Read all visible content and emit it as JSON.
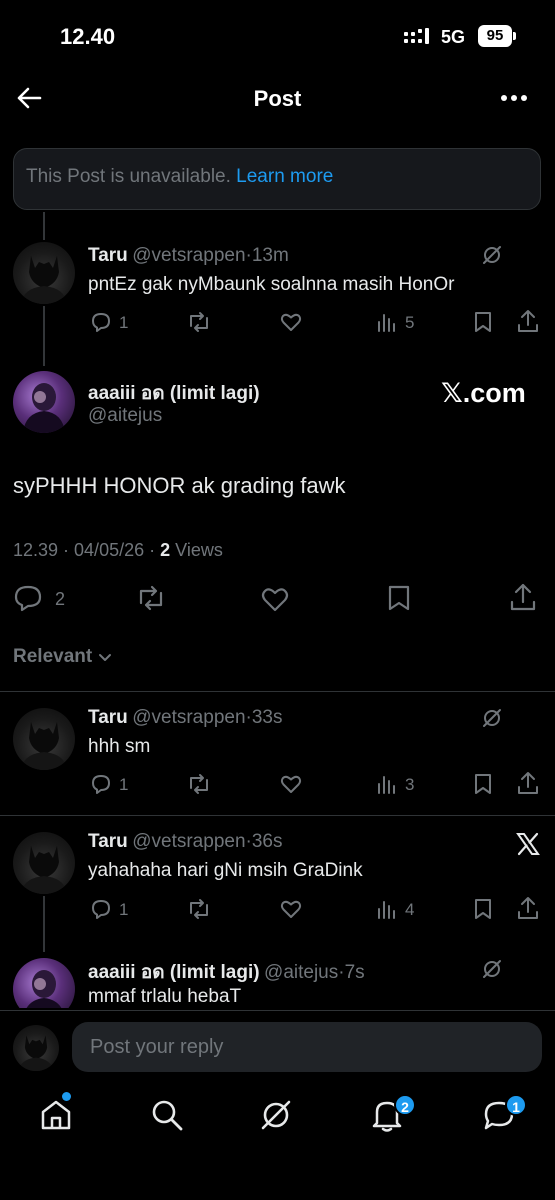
{
  "status_bar": {
    "time": "12.40",
    "network": "5G",
    "battery": "95"
  },
  "header": {
    "title": "Post"
  },
  "unavailable": {
    "text": "This Post is unavailable.",
    "link": "Learn more"
  },
  "reply1": {
    "name": "Taru",
    "handle": "@vetsrappen",
    "time": "13m",
    "text": "pntEz gak nyMbaunk soalnna masih HonOr",
    "replies": "1",
    "views": "5"
  },
  "main_post": {
    "name": "aaaiii อด (limit lagi)",
    "handle": "@aitejus",
    "watermark": "𝕏.com",
    "text": "syPHHH HONOR ak grading fawk",
    "timestamp": "12.39 · 04/05/26 ·",
    "views_count": "2",
    "views_label": "Views",
    "replies": "2"
  },
  "sort": {
    "label": "Relevant"
  },
  "reply2": {
    "name": "Taru",
    "handle": "@vetsrappen",
    "time": "33s",
    "text": "hhh sm",
    "replies": "1",
    "views": "3"
  },
  "reply3": {
    "name": "Taru",
    "handle": "@vetsrappen",
    "time": "36s",
    "text": "yahahaha hari gNi msih GraDink",
    "replies": "1",
    "views": "4"
  },
  "reply4": {
    "name": "aaaiii อด (limit lagi)",
    "handle": "@aitejus",
    "time": "7s",
    "text": "mmaf trlalu hebaT"
  },
  "composer": {
    "placeholder": "Post your reply"
  },
  "nav": {
    "notifications_badge": "2",
    "messages_badge": "1"
  },
  "colors": {
    "accent": "#1d9bf0",
    "background": "#000000",
    "muted": "#71767b"
  }
}
